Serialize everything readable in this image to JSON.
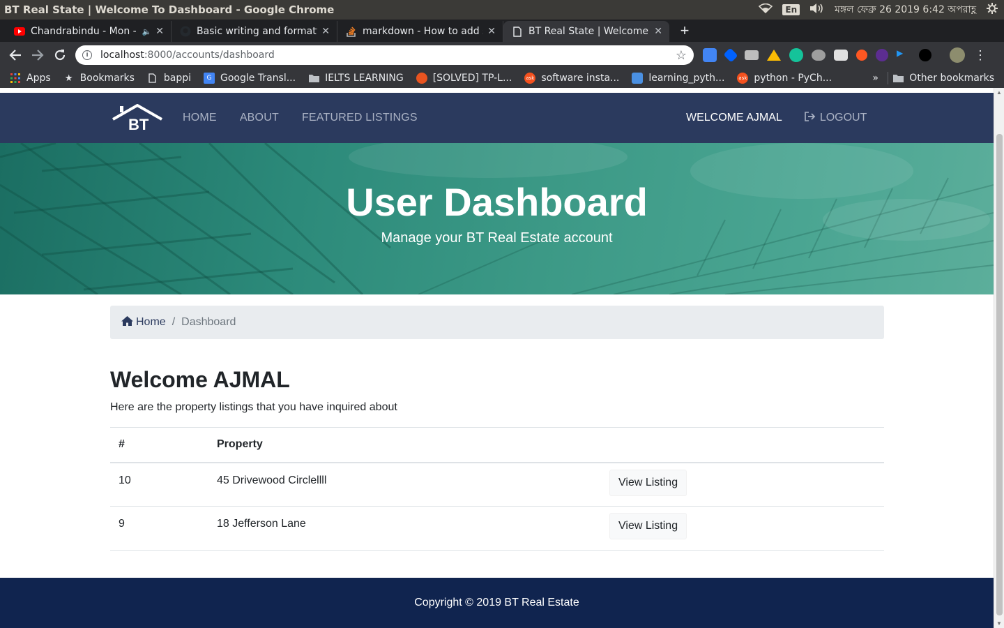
{
  "os": {
    "window_title": "BT Real State | Welcome To Dashboard - Google Chrome",
    "lang": "En",
    "clock": "মঙ্গল ফেব্রু 26 2019  6:42 অপরাহ্ণ"
  },
  "tabs": [
    {
      "label": "Chandrabindu - Mon - ",
      "icon": "youtube-icon",
      "audio": "🔈"
    },
    {
      "label": "Basic writing and formatt",
      "icon": "github-icon"
    },
    {
      "label": "markdown - How to add s",
      "icon": "stackoverflow-icon"
    },
    {
      "label": "BT Real State | Welcome T",
      "icon": "page-icon"
    }
  ],
  "omnibox": {
    "host": "localhost",
    "path": ":8000/accounts/dashboard"
  },
  "bookmarks": [
    {
      "label": "Apps"
    },
    {
      "label": "Bookmarks"
    },
    {
      "label": "bappi"
    },
    {
      "label": "Google Transl..."
    },
    {
      "label": "IELTS LEARNING"
    },
    {
      "label": "[SOLVED] TP-L..."
    },
    {
      "label": "software insta..."
    },
    {
      "label": "learning_pyth..."
    },
    {
      "label": "python - PyCh..."
    }
  ],
  "bookmarks_more": "»",
  "bookmarks_other": "Other bookmarks",
  "site": {
    "logo_text": "BT",
    "nav": [
      "HOME",
      "ABOUT",
      "FEATURED LISTINGS"
    ],
    "welcome": "WELCOME AJMAL",
    "logout": "LOGOUT"
  },
  "hero": {
    "title": "User Dashboard",
    "subtitle": "Manage your BT Real Estate account"
  },
  "breadcrumb": {
    "home": "Home",
    "separator": "/",
    "current": "Dashboard"
  },
  "main": {
    "heading": "Welcome AJMAL",
    "lead": "Here are the property listings that you have inquired about"
  },
  "table": {
    "headers": [
      "#",
      "Property",
      ""
    ],
    "rows": [
      {
        "id": "10",
        "property": "45 Drivewood Circlellll",
        "action": "View Listing"
      },
      {
        "id": "9",
        "property": "18 Jefferson Lane",
        "action": "View Listing"
      }
    ]
  },
  "footer": {
    "text": "Copyright © 2019 BT Real Estate"
  },
  "colors": {
    "navbar": "#2b3a5e",
    "footer": "#10244f",
    "hero": "#3c9986",
    "breadcrumb_bg": "#e9ecef"
  }
}
